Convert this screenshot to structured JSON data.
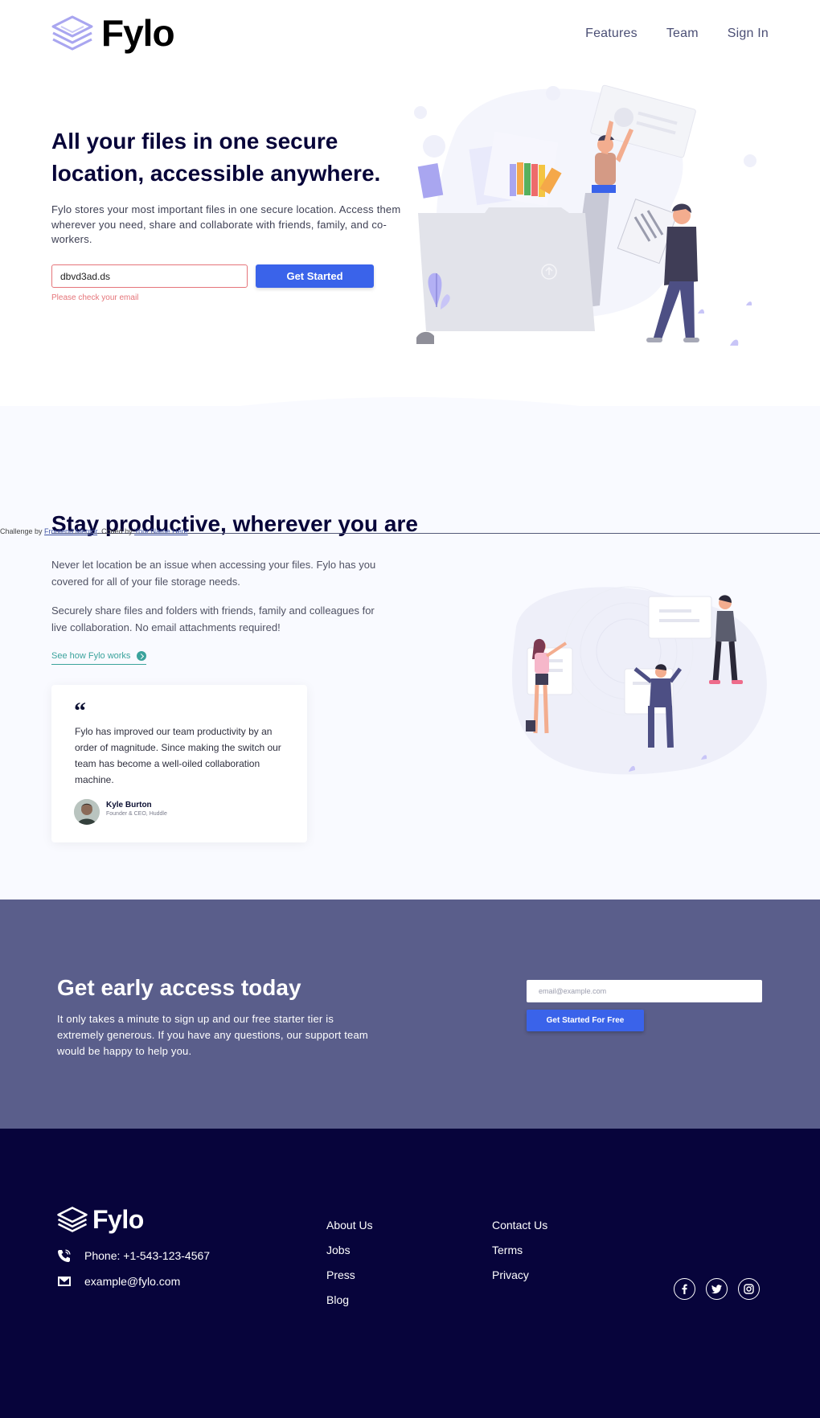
{
  "header": {
    "logo_text": "Fylo",
    "nav": [
      "Features",
      "Team",
      "Sign In"
    ]
  },
  "hero": {
    "title": "All your files in one secure location, accessible anywhere.",
    "text": "Fylo stores your most important files in one secure location. Access them wherever you need, share and collaborate with friends, family, and co-workers.",
    "email_value": "dbvd3ad.ds",
    "button_label": "Get Started",
    "error": "Please check your email"
  },
  "attribution": {
    "prefix": "Challenge by ",
    "link1": "Frontend Mentor",
    "middle": ". Coded by ",
    "link2": "Your Name Here",
    "suffix": "."
  },
  "productive": {
    "title": "Stay productive, wherever you are",
    "p1": "Never let location be an issue when accessing your files. Fylo has you covered for all of your file storage needs.",
    "p2": "Securely share files and folders with friends, family and colleagues for live collaboration. No email attachments required!",
    "link": "See how Fylo works",
    "testimonial": {
      "quote_mark": "“",
      "text": "Fylo has improved our team productivity by an order of magnitude. Since making the switch our team has become a well-oiled collaboration machine.",
      "name": "Kyle Burton",
      "role": "Founder & CEO, Huddle"
    }
  },
  "early": {
    "title": "Get early access today",
    "text": "It only takes a minute to sign up and our free starter tier is extremely generous. If you have any questions, our support team would be happy to help you.",
    "placeholder": "email@example.com",
    "button_label": "Get Started For Free"
  },
  "footer": {
    "logo_text": "Fylo",
    "phone": "Phone: +1-543-123-4567",
    "email": "example@fylo.com",
    "col1": [
      "About Us",
      "Jobs",
      "Press",
      "Blog"
    ],
    "col2": [
      "Contact Us",
      "Terms",
      "Privacy"
    ],
    "socials": [
      "facebook-icon",
      "twitter-icon",
      "instagram-icon"
    ]
  },
  "colors": {
    "primary_blue": "#3a63ea",
    "dark_navy": "#07043b",
    "early_bg": "#5a5e8b",
    "error": "#e5757a",
    "teal": "#3ba39c",
    "light_bg": "#f9faff"
  }
}
